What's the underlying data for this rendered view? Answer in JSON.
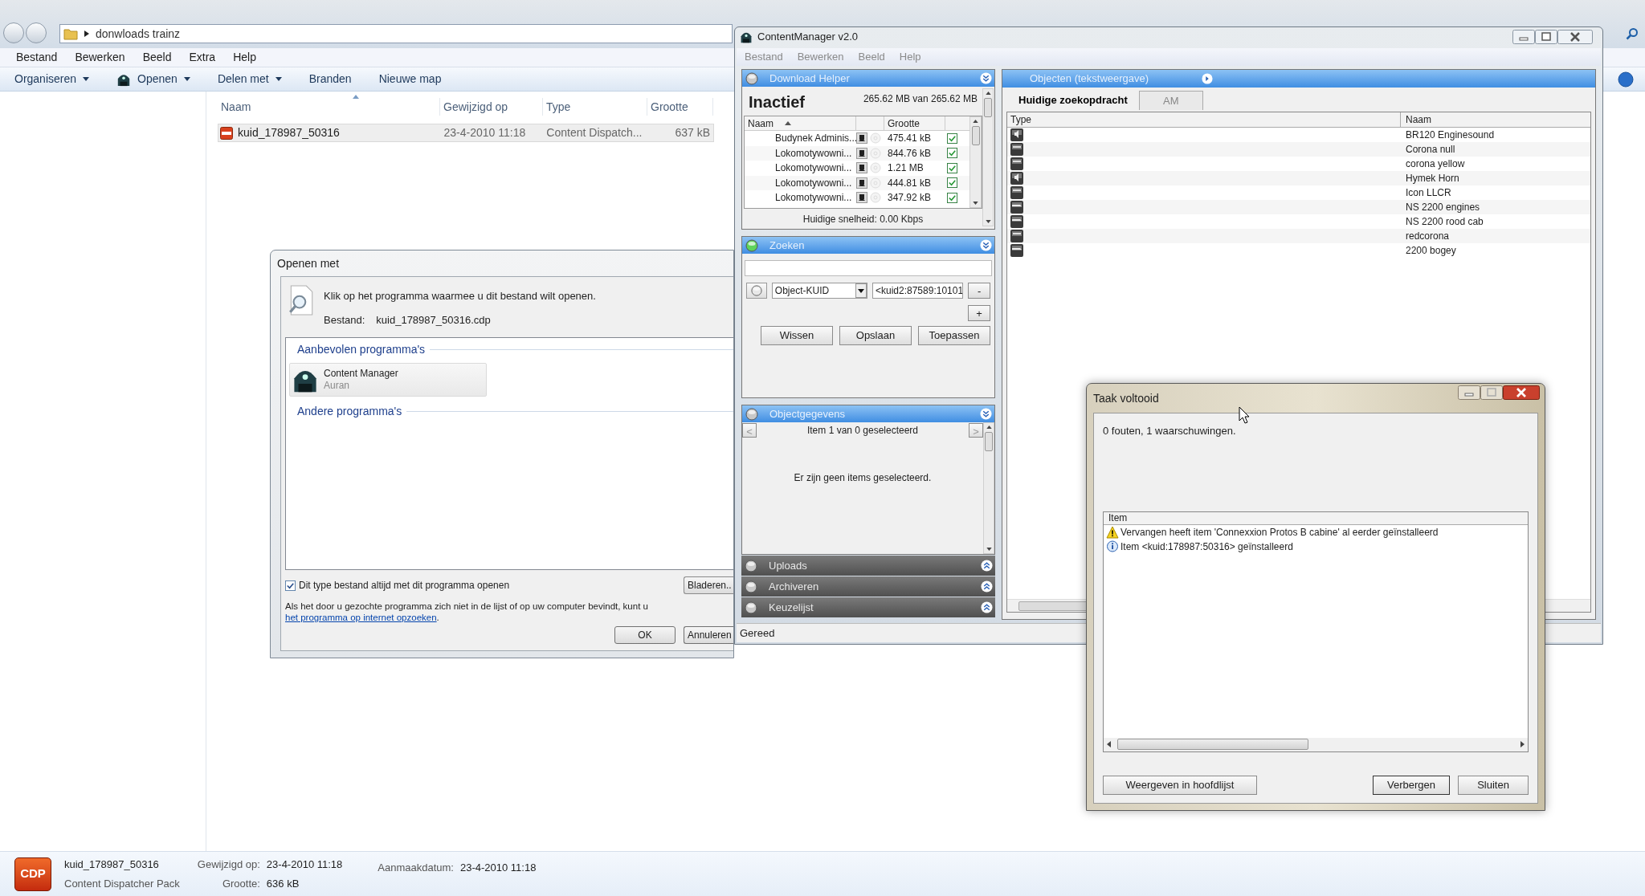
{
  "explorer": {
    "breadcrumb": "donwloads trainz",
    "menu": [
      "Bestand",
      "Bewerken",
      "Beeld",
      "Extra",
      "Help"
    ],
    "toolbar": [
      {
        "label": "Organiseren",
        "dropdown": true,
        "icon": false
      },
      {
        "label": "Openen",
        "dropdown": true,
        "icon": true
      },
      {
        "label": "Delen met",
        "dropdown": true,
        "icon": false
      },
      {
        "label": "Branden",
        "dropdown": false,
        "icon": false
      },
      {
        "label": "Nieuwe map",
        "dropdown": false,
        "icon": false
      }
    ],
    "columns": [
      "Naam",
      "Gewijzigd op",
      "Type",
      "Grootte"
    ],
    "files": [
      {
        "name": "kuid_178987_50316",
        "modified": "23-4-2010 11:18",
        "type": "Content Dispatch...",
        "size": "637 kB",
        "selected": true
      }
    ],
    "details": {
      "badge": "CDP",
      "name": "kuid_178987_50316",
      "type": "Content Dispatcher Pack",
      "modified_label": "Gewijzigd op:",
      "modified": "23-4-2010 11:18",
      "size_label": "Grootte:",
      "size": "636 kB",
      "created_label": "Aanmaakdatum:",
      "created": "23-4-2010 11:18"
    }
  },
  "open_with": {
    "title": "Openen met",
    "instruction": "Klik op het programma waarmee u dit bestand wilt openen.",
    "file_label": "Bestand:",
    "file": "kuid_178987_50316.cdp",
    "recommended_heading": "Aanbevolen programma's",
    "programs": [
      {
        "name": "Content Manager",
        "publisher": "Auran"
      }
    ],
    "other_heading": "Andere programma's",
    "always": {
      "label": "Dit type bestand altijd met dit programma openen",
      "checked": true
    },
    "note": "Als het door u gezochte programma zich niet in de lijst of op uw computer bevindt, kunt u ",
    "note_link": "het programma op internet opzoeken",
    "note_end": ".",
    "browse": "Bladeren..",
    "ok": "OK",
    "cancel": "Annuleren"
  },
  "content_manager": {
    "title": "ContentManager v2.0",
    "menu": [
      "Bestand",
      "Bewerken",
      "Beeld",
      "Help"
    ],
    "download_helper": {
      "title": "Download Helper",
      "active": false,
      "expanded": true,
      "status": "Inactief",
      "total": "265.62 MB van 265.62 MB",
      "columns": [
        "Naam",
        "Grootte"
      ],
      "rows": [
        {
          "name": "Budynek Adminis...",
          "size": "475.41 kB",
          "checked": true
        },
        {
          "name": "Lokomotywowni...",
          "size": "844.76 kB",
          "checked": true
        },
        {
          "name": "Lokomotywowni...",
          "size": "1.21 MB",
          "checked": true
        },
        {
          "name": "Lokomotywowni...",
          "size": "444.81 kB",
          "checked": true
        },
        {
          "name": "Lokomotywowni...",
          "size": "347.92 kB",
          "checked": true
        }
      ],
      "speed": "Huidige snelheid: 0.00 Kbps"
    },
    "search": {
      "title": "Zoeken",
      "active": true,
      "expanded": true,
      "filter": "Object-KUID",
      "value": "<kuid2:87589:10101",
      "minus": "-",
      "plus": "+",
      "buttons": [
        "Wissen",
        "Opslaan",
        "Toepassen"
      ]
    },
    "details": {
      "title": "Objectgegevens",
      "active": false,
      "expanded": true,
      "prev": "<",
      "next": ">",
      "position": "Item 1 van 0 geselecteerd",
      "empty": "Er zijn geen items geselecteerd."
    },
    "collapsed_panels": [
      {
        "title": "Uploads",
        "expanded": false
      },
      {
        "title": "Archiveren",
        "expanded": false
      },
      {
        "title": "Keuzelijst",
        "expanded": false
      }
    ],
    "status": "Gereed",
    "objects": {
      "title": "Objecten (tekstweergave)",
      "tabs": [
        {
          "label": "Huidige zoekopdracht",
          "selected": true
        },
        {
          "label": "AM",
          "selected": false
        }
      ],
      "columns": [
        "Type",
        "Naam"
      ],
      "rows": [
        {
          "kind": "sound",
          "name": "BR120 Enginesound"
        },
        {
          "kind": "scenery",
          "name": "Corona null"
        },
        {
          "kind": "scenery",
          "name": "corona yellow"
        },
        {
          "kind": "sound",
          "name": "Hymek Horn"
        },
        {
          "kind": "scenery",
          "name": "Icon LLCR"
        },
        {
          "kind": "train",
          "name": "NS 2200 engines"
        },
        {
          "kind": "train",
          "name": "NS 2200 rood cab"
        },
        {
          "kind": "scenery",
          "name": "redcorona"
        },
        {
          "kind": "train",
          "name": "2200 bogey"
        }
      ]
    }
  },
  "task": {
    "title": "Taak voltooid",
    "summary": "0 fouten, 1 waarschuwingen.",
    "column": "Item",
    "messages": [
      {
        "kind": "warning",
        "text": "Vervangen heeft item 'Connexxion Protos B cabine' al eerder geïnstalleerd"
      },
      {
        "kind": "info",
        "text": "Item <kuid:178987:50316> geïnstalleerd"
      }
    ],
    "buttons": [
      "Weergeven in hoofdlijst",
      "Verbergen",
      "Sluiten"
    ]
  }
}
